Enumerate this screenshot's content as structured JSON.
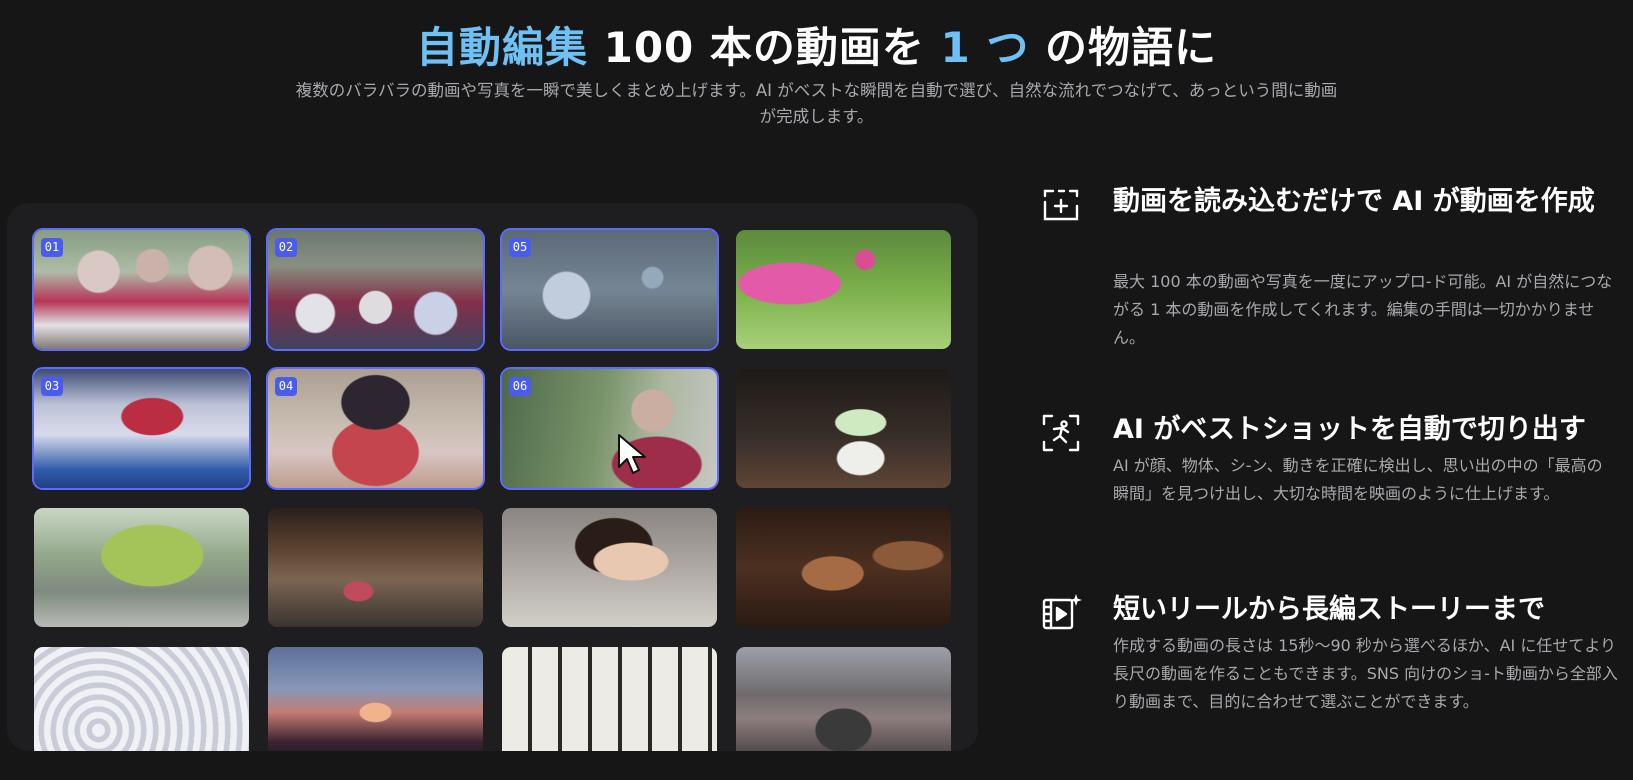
{
  "hero": {
    "title_accent_1": "自動編集",
    "title_mid": " 100 本の動画を ",
    "title_accent_2": "1 つ",
    "title_end": " の物語に",
    "subtitle": "複数のバラバラの動画や写真を一瞬で美しくまとめ上げます。AI がベストな瞬間を自動で選び、自然な流れでつなげて、あっという間に動画が完成します。"
  },
  "gallery": {
    "tiles": [
      {
        "badge": "01",
        "selected": true,
        "scene": "yukata-friends-walking"
      },
      {
        "badge": "02",
        "selected": true,
        "scene": "yukata-back-view"
      },
      {
        "badge": "05",
        "selected": true,
        "scene": "wind-chimes"
      },
      {
        "badge": "",
        "selected": false,
        "scene": "lotus-flower"
      },
      {
        "badge": "03",
        "selected": true,
        "scene": "kakigori-flag"
      },
      {
        "badge": "04",
        "selected": true,
        "scene": "eating-watermelon"
      },
      {
        "badge": "06",
        "selected": true,
        "scene": "yukata-woman-smiling"
      },
      {
        "badge": "",
        "selected": false,
        "scene": "shaved-ice-cup"
      },
      {
        "badge": "",
        "selected": false,
        "scene": "willow-tree"
      },
      {
        "badge": "",
        "selected": false,
        "scene": "street-food-stall"
      },
      {
        "badge": "",
        "selected": false,
        "scene": "woman-portrait"
      },
      {
        "badge": "",
        "selected": false,
        "scene": "ema-wooden-plaques"
      },
      {
        "badge": "",
        "selected": false,
        "scene": "white-ornaments"
      },
      {
        "badge": "",
        "selected": false,
        "scene": "river-lanterns-dusk"
      },
      {
        "badge": "",
        "selected": false,
        "scene": "paper-lanterns-wall"
      },
      {
        "badge": "",
        "selected": false,
        "scene": "canal-cherry-trees"
      }
    ]
  },
  "features": [
    {
      "icon": "video-add-icon",
      "title": "動画を読み込むだけで AI が動画を作成",
      "desc": "最大 100 本の動画や写真を一度にアップロ-ド可能。AI が自然につながる 1 本の動画を作成してくれます。編集の手間は一切かかりません。"
    },
    {
      "icon": "best-shot-icon",
      "title": "AI がベストショットを自動で切り出す",
      "desc": "AI が顔、物体、シ-ン、動きを正確に検出し、思い出の中の「最高の瞬間」を見つけ出し、大切な時間を映画のように仕上げます。"
    },
    {
      "icon": "video-sparkle-icon",
      "title": "短いリールから長編ストーリーまで",
      "desc": "作成する動画の長さは 15秒～90 秒から選べるほか、AI に任せてより長尺の動画を作ることもできます。SNS 向けのショ-ト動画から全部入り動画まで、目的に合わせて選ぶことができます。"
    }
  ],
  "colors": {
    "accent": "#6fc0f5",
    "selection_border": "#5b6cff",
    "badge": "#4a5cf0",
    "background": "#161617",
    "panel": "#1e1e21"
  }
}
